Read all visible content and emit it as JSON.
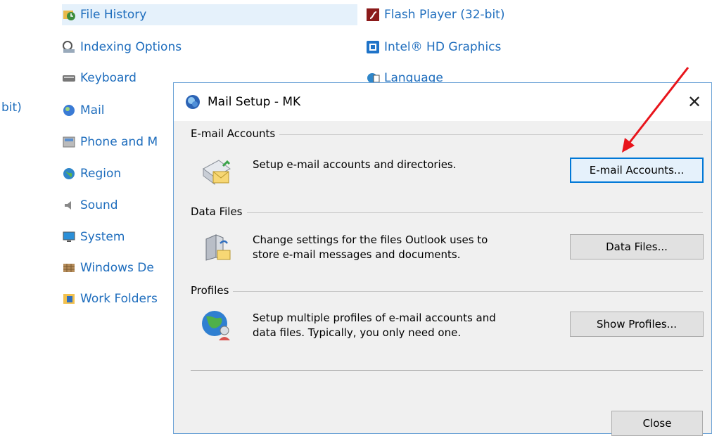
{
  "background": {
    "partial_label": "bit)",
    "left_column": [
      {
        "label": "File History",
        "icon": "file-history-icon"
      },
      {
        "label": "Indexing Options",
        "icon": "indexing-options-icon"
      },
      {
        "label": "Keyboard",
        "icon": "keyboard-icon"
      },
      {
        "label": "Mail",
        "icon": "mail-icon"
      },
      {
        "label": "Phone and M",
        "icon": "phone-modem-icon"
      },
      {
        "label": "Region",
        "icon": "region-icon"
      },
      {
        "label": "Sound",
        "icon": "sound-icon"
      },
      {
        "label": "System",
        "icon": "system-icon"
      },
      {
        "label": "Windows De",
        "icon": "windows-defender-icon"
      },
      {
        "label": "Work Folders",
        "icon": "work-folders-icon"
      }
    ],
    "right_column": [
      {
        "label": "Flash Player (32-bit)",
        "icon": "flash-player-icon"
      },
      {
        "label": "Intel® HD Graphics",
        "icon": "intel-graphics-icon"
      },
      {
        "label": "Language",
        "icon": "language-icon"
      }
    ]
  },
  "dialog": {
    "title": "Mail Setup - MK",
    "close_glyph": "✕",
    "email_section": {
      "title": "E-mail Accounts",
      "description": "Setup e-mail accounts and directories.",
      "button": "E-mail Accounts..."
    },
    "data_files_section": {
      "title": "Data Files",
      "description_line1": "Change settings for the files Outlook uses to",
      "description_line2": "store e-mail messages and documents.",
      "button": "Data Files..."
    },
    "profiles_section": {
      "title": "Profiles",
      "description_line1": "Setup multiple profiles of e-mail accounts and",
      "description_line2": "data files. Typically, you only need one.",
      "button": "Show Profiles..."
    },
    "close_button": "Close"
  },
  "colors": {
    "link": "#1e6dbd",
    "focus": "#0078d7",
    "arrow": "#e8141b"
  }
}
